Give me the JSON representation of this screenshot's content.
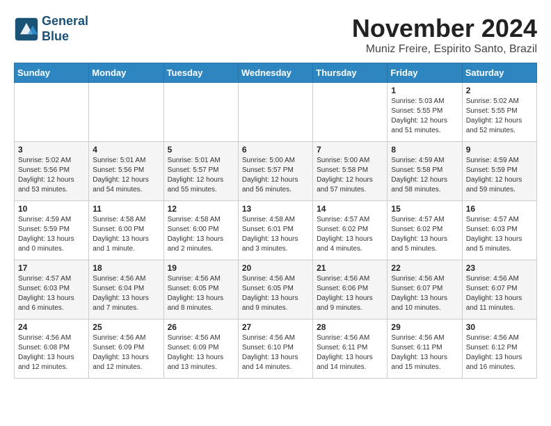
{
  "header": {
    "logo_line1": "General",
    "logo_line2": "Blue",
    "month": "November 2024",
    "location": "Muniz Freire, Espirito Santo, Brazil"
  },
  "weekdays": [
    "Sunday",
    "Monday",
    "Tuesday",
    "Wednesday",
    "Thursday",
    "Friday",
    "Saturday"
  ],
  "rows": [
    [
      {
        "day": "",
        "info": ""
      },
      {
        "day": "",
        "info": ""
      },
      {
        "day": "",
        "info": ""
      },
      {
        "day": "",
        "info": ""
      },
      {
        "day": "",
        "info": ""
      },
      {
        "day": "1",
        "info": "Sunrise: 5:03 AM\nSunset: 5:55 PM\nDaylight: 12 hours\nand 51 minutes."
      },
      {
        "day": "2",
        "info": "Sunrise: 5:02 AM\nSunset: 5:55 PM\nDaylight: 12 hours\nand 52 minutes."
      }
    ],
    [
      {
        "day": "3",
        "info": "Sunrise: 5:02 AM\nSunset: 5:56 PM\nDaylight: 12 hours\nand 53 minutes."
      },
      {
        "day": "4",
        "info": "Sunrise: 5:01 AM\nSunset: 5:56 PM\nDaylight: 12 hours\nand 54 minutes."
      },
      {
        "day": "5",
        "info": "Sunrise: 5:01 AM\nSunset: 5:57 PM\nDaylight: 12 hours\nand 55 minutes."
      },
      {
        "day": "6",
        "info": "Sunrise: 5:00 AM\nSunset: 5:57 PM\nDaylight: 12 hours\nand 56 minutes."
      },
      {
        "day": "7",
        "info": "Sunrise: 5:00 AM\nSunset: 5:58 PM\nDaylight: 12 hours\nand 57 minutes."
      },
      {
        "day": "8",
        "info": "Sunrise: 4:59 AM\nSunset: 5:58 PM\nDaylight: 12 hours\nand 58 minutes."
      },
      {
        "day": "9",
        "info": "Sunrise: 4:59 AM\nSunset: 5:59 PM\nDaylight: 12 hours\nand 59 minutes."
      }
    ],
    [
      {
        "day": "10",
        "info": "Sunrise: 4:59 AM\nSunset: 5:59 PM\nDaylight: 13 hours\nand 0 minutes."
      },
      {
        "day": "11",
        "info": "Sunrise: 4:58 AM\nSunset: 6:00 PM\nDaylight: 13 hours\nand 1 minute."
      },
      {
        "day": "12",
        "info": "Sunrise: 4:58 AM\nSunset: 6:00 PM\nDaylight: 13 hours\nand 2 minutes."
      },
      {
        "day": "13",
        "info": "Sunrise: 4:58 AM\nSunset: 6:01 PM\nDaylight: 13 hours\nand 3 minutes."
      },
      {
        "day": "14",
        "info": "Sunrise: 4:57 AM\nSunset: 6:02 PM\nDaylight: 13 hours\nand 4 minutes."
      },
      {
        "day": "15",
        "info": "Sunrise: 4:57 AM\nSunset: 6:02 PM\nDaylight: 13 hours\nand 5 minutes."
      },
      {
        "day": "16",
        "info": "Sunrise: 4:57 AM\nSunset: 6:03 PM\nDaylight: 13 hours\nand 5 minutes."
      }
    ],
    [
      {
        "day": "17",
        "info": "Sunrise: 4:57 AM\nSunset: 6:03 PM\nDaylight: 13 hours\nand 6 minutes."
      },
      {
        "day": "18",
        "info": "Sunrise: 4:56 AM\nSunset: 6:04 PM\nDaylight: 13 hours\nand 7 minutes."
      },
      {
        "day": "19",
        "info": "Sunrise: 4:56 AM\nSunset: 6:05 PM\nDaylight: 13 hours\nand 8 minutes."
      },
      {
        "day": "20",
        "info": "Sunrise: 4:56 AM\nSunset: 6:05 PM\nDaylight: 13 hours\nand 9 minutes."
      },
      {
        "day": "21",
        "info": "Sunrise: 4:56 AM\nSunset: 6:06 PM\nDaylight: 13 hours\nand 9 minutes."
      },
      {
        "day": "22",
        "info": "Sunrise: 4:56 AM\nSunset: 6:07 PM\nDaylight: 13 hours\nand 10 minutes."
      },
      {
        "day": "23",
        "info": "Sunrise: 4:56 AM\nSunset: 6:07 PM\nDaylight: 13 hours\nand 11 minutes."
      }
    ],
    [
      {
        "day": "24",
        "info": "Sunrise: 4:56 AM\nSunset: 6:08 PM\nDaylight: 13 hours\nand 12 minutes."
      },
      {
        "day": "25",
        "info": "Sunrise: 4:56 AM\nSunset: 6:09 PM\nDaylight: 13 hours\nand 12 minutes."
      },
      {
        "day": "26",
        "info": "Sunrise: 4:56 AM\nSunset: 6:09 PM\nDaylight: 13 hours\nand 13 minutes."
      },
      {
        "day": "27",
        "info": "Sunrise: 4:56 AM\nSunset: 6:10 PM\nDaylight: 13 hours\nand 14 minutes."
      },
      {
        "day": "28",
        "info": "Sunrise: 4:56 AM\nSunset: 6:11 PM\nDaylight: 13 hours\nand 14 minutes."
      },
      {
        "day": "29",
        "info": "Sunrise: 4:56 AM\nSunset: 6:11 PM\nDaylight: 13 hours\nand 15 minutes."
      },
      {
        "day": "30",
        "info": "Sunrise: 4:56 AM\nSunset: 6:12 PM\nDaylight: 13 hours\nand 16 minutes."
      }
    ]
  ]
}
